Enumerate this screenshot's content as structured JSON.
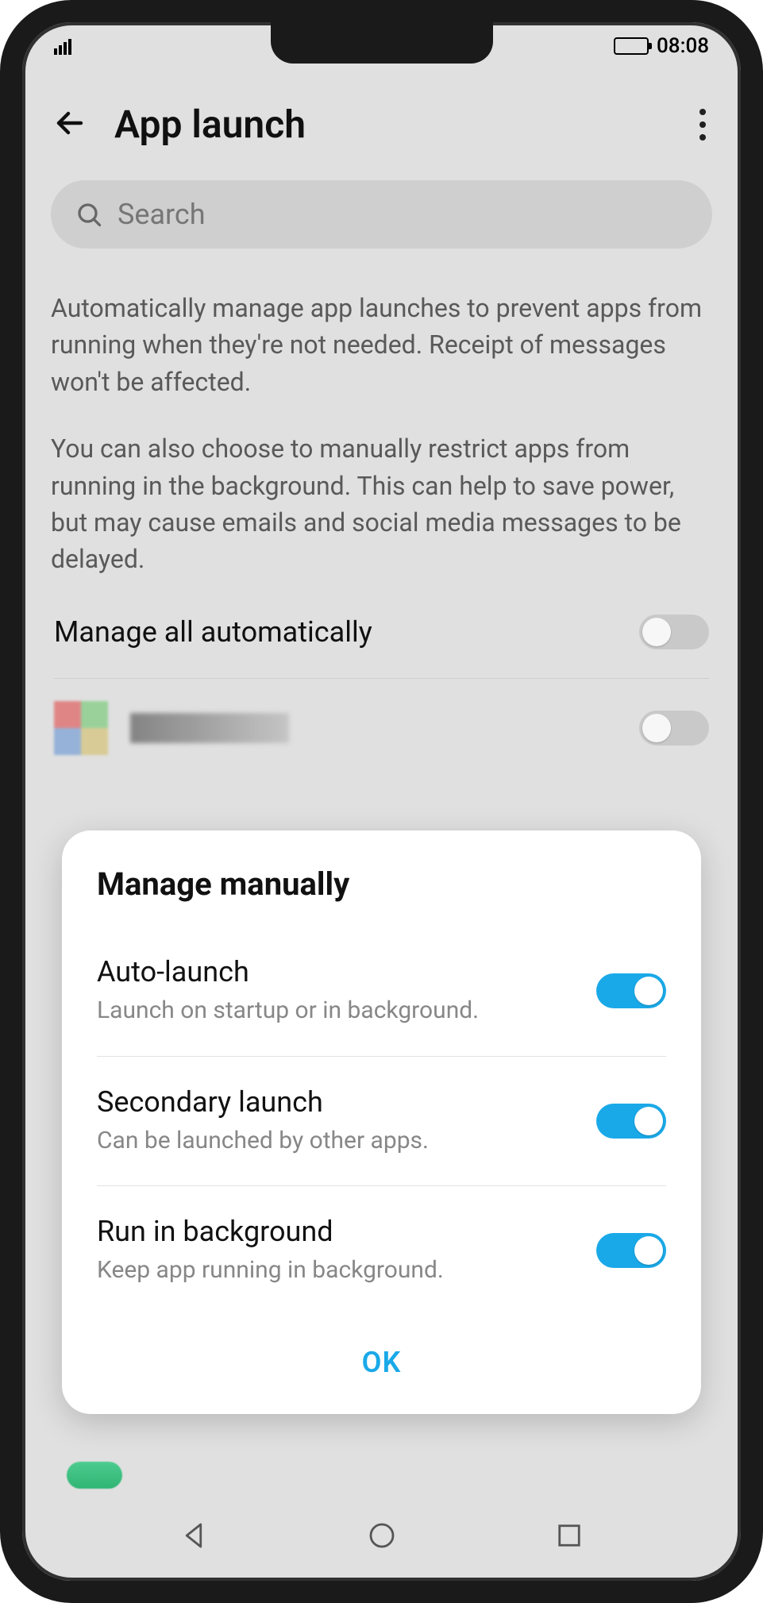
{
  "status": {
    "time": "08:08"
  },
  "header": {
    "title": "App launch"
  },
  "search": {
    "placeholder": "Search"
  },
  "description": {
    "p1": "Automatically manage app launches to prevent apps from running when they're not needed. Receipt of messages won't be affected.",
    "p2": "You can also choose to manually restrict apps from running in the background. This can help to save power, but may cause emails and social media messages to be delayed."
  },
  "manage_all": {
    "label": "Manage all automatically",
    "enabled": false
  },
  "dialog": {
    "title": "Manage manually",
    "rows": {
      "auto_launch": {
        "label": "Auto-launch",
        "sub": "Launch on startup or in background.",
        "enabled": true
      },
      "secondary_launch": {
        "label": "Secondary launch",
        "sub": "Can be launched by other apps.",
        "enabled": true
      },
      "run_bg": {
        "label": "Run in background",
        "sub": "Keep app running in background.",
        "enabled": true
      }
    },
    "ok": "OK"
  }
}
